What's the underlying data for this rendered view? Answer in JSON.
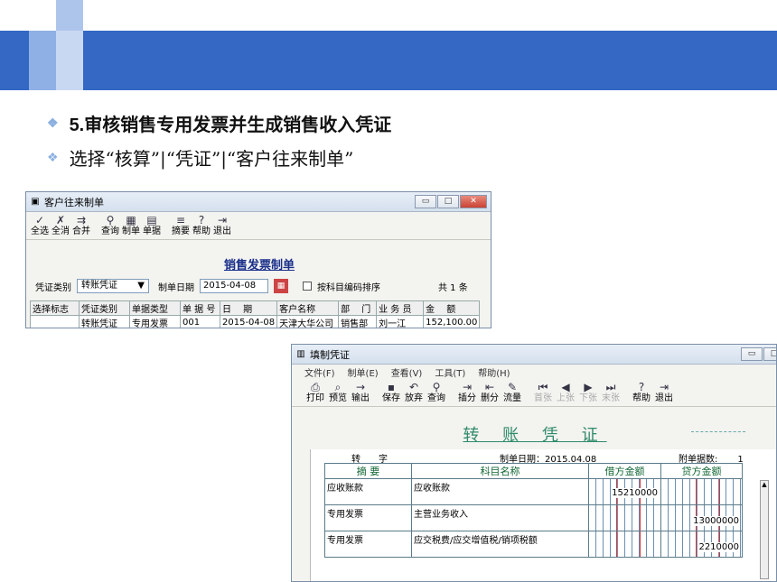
{
  "slide": {
    "bullet1_num": "5.",
    "bullet1_text": "审核销售专用发票并生成销售收入凭证",
    "bullet2_text": "选择“核算”|“凭证”|“客户往来制单”"
  },
  "window1": {
    "title": "客户往来制单",
    "toolbar": [
      "全选",
      "全消",
      "合并",
      "查询",
      "制单",
      "单据",
      "摘要",
      "帮助",
      "退出"
    ],
    "heading": "销售发票制单",
    "voucher_type_label": "凭证类别",
    "voucher_type_value": "转账凭证",
    "date_label": "制单日期",
    "date_value": "2015-04-08",
    "sort_label": "按科目编码排序",
    "count": "共 1 条",
    "columns": [
      "选择标志",
      "凭证类别",
      "单据类型",
      "单 据 号",
      "日　 期",
      "客户名称",
      "部　 门",
      "业 务 员",
      "金　 额"
    ],
    "rows": [
      [
        "",
        "转账凭证",
        "专用发票",
        "001",
        "2015-04-08",
        "天津大华公司",
        "销售部",
        "刘一江",
        "152,100.00"
      ]
    ]
  },
  "window2": {
    "title": "填制凭证",
    "menu": [
      "文件(F)",
      "制单(E)",
      "查看(V)",
      "工具(T)",
      "帮助(H)"
    ],
    "toolbar": [
      "打印",
      "预览",
      "输出",
      "保存",
      "放弃",
      "查询",
      "插分",
      "删分",
      "流量",
      "首张",
      "上张",
      "下张",
      "末张",
      "帮助",
      "退出"
    ],
    "voucher_title": "转 账 凭 证",
    "zi_label": "转　　字",
    "date_text": "制单日期：2015.04.08",
    "attachments_label": "附单据数:",
    "attachments_value": "1",
    "columns": [
      "摘 要",
      "科目名称",
      "借方金额",
      "贷方金额"
    ],
    "entries": [
      {
        "summary": "应收账款",
        "account": "应收账款",
        "debit": "15210000",
        "credit": ""
      },
      {
        "summary": "专用发票",
        "account": "主营业务收入",
        "debit": "",
        "credit": "13000000"
      },
      {
        "summary": "专用发票",
        "account": "应交税费/应交增值税/销项税额",
        "debit": "",
        "credit": "2210000"
      }
    ]
  },
  "colors": {
    "accent": "#3468c4",
    "title_blue": "#1a2f8a",
    "voucher_green": "#2f8a6a"
  }
}
